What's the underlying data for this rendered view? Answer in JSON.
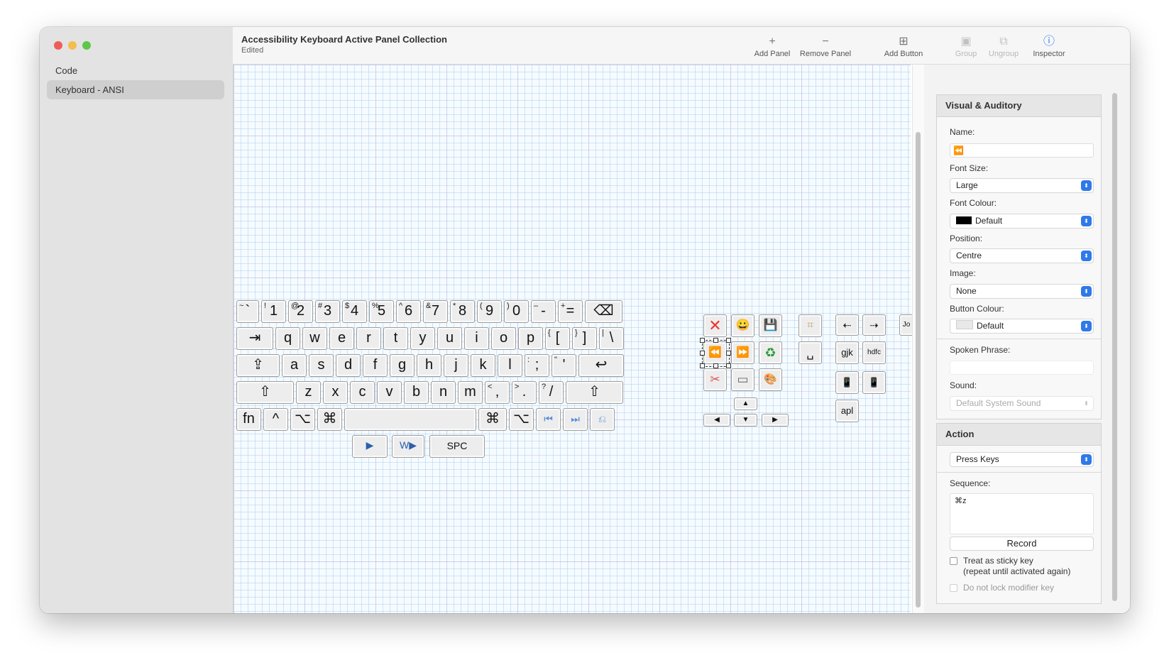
{
  "sidebar": {
    "items": [
      {
        "label": "Code"
      },
      {
        "label": "Keyboard - ANSI"
      }
    ]
  },
  "header": {
    "title": "Accessibility Keyboard Active Panel Collection",
    "subtitle": "Edited"
  },
  "toolbar": {
    "add_panel": "Add Panel",
    "add_panel_icon": "+",
    "remove_panel": "Remove Panel",
    "remove_panel_icon": "−",
    "add_button": "Add Button",
    "add_button_icon": "⊞",
    "group": "Group",
    "group_icon": "▣",
    "ungroup": "Ungroup",
    "ungroup_icon": "⧉",
    "inspector": "Inspector",
    "inspector_icon": "ⓘ"
  },
  "keyboard": {
    "row1": [
      {
        "m": "`",
        "k": "~"
      },
      {
        "m": "1",
        "k": "!"
      },
      {
        "m": "2",
        "k": "@"
      },
      {
        "m": "3",
        "k": "#"
      },
      {
        "m": "4",
        "k": "$"
      },
      {
        "m": "5",
        "k": "%"
      },
      {
        "m": "6",
        "k": "^"
      },
      {
        "m": "7",
        "k": "&"
      },
      {
        "m": "8",
        "k": "*"
      },
      {
        "m": "9",
        "k": "("
      },
      {
        "m": "0",
        "k": ")"
      },
      {
        "m": "-",
        "k": "–"
      },
      {
        "m": "=",
        "k": "+"
      },
      {
        "m": "⌫",
        "k": ""
      }
    ],
    "row2": [
      {
        "m": "⇥",
        "k": ""
      },
      {
        "m": "q",
        "k": ""
      },
      {
        "m": "w",
        "k": ""
      },
      {
        "m": "e",
        "k": ""
      },
      {
        "m": "r",
        "k": ""
      },
      {
        "m": "t",
        "k": ""
      },
      {
        "m": "y",
        "k": ""
      },
      {
        "m": "u",
        "k": ""
      },
      {
        "m": "i",
        "k": ""
      },
      {
        "m": "o",
        "k": ""
      },
      {
        "m": "p",
        "k": ""
      },
      {
        "m": "[",
        "k": "{"
      },
      {
        "m": "]",
        "k": "}"
      },
      {
        "m": "\\",
        "k": "|"
      }
    ],
    "row3": [
      {
        "m": "⇪",
        "k": ""
      },
      {
        "m": "a",
        "k": ""
      },
      {
        "m": "s",
        "k": ""
      },
      {
        "m": "d",
        "k": ""
      },
      {
        "m": "f",
        "k": ""
      },
      {
        "m": "g",
        "k": ""
      },
      {
        "m": "h",
        "k": ""
      },
      {
        "m": "j",
        "k": ""
      },
      {
        "m": "k",
        "k": ""
      },
      {
        "m": "l",
        "k": ""
      },
      {
        "m": ";",
        "k": ":"
      },
      {
        "m": "'",
        "k": "\""
      },
      {
        "m": "↩",
        "k": ""
      }
    ],
    "row4": [
      {
        "m": "⇧",
        "k": ""
      },
      {
        "m": "z",
        "k": ""
      },
      {
        "m": "x",
        "k": ""
      },
      {
        "m": "c",
        "k": ""
      },
      {
        "m": "v",
        "k": ""
      },
      {
        "m": "b",
        "k": ""
      },
      {
        "m": "n",
        "k": ""
      },
      {
        "m": "m",
        "k": ""
      },
      {
        "m": ",",
        "k": "<"
      },
      {
        "m": ".",
        "k": ">"
      },
      {
        "m": "/",
        "k": "?"
      },
      {
        "m": "⇧",
        "k": ""
      }
    ],
    "row5": [
      {
        "m": "fn"
      },
      {
        "m": "^"
      },
      {
        "m": "⌥"
      },
      {
        "m": "⌘"
      },
      {
        "m": ""
      },
      {
        "m": "⌘"
      },
      {
        "m": "⌥"
      },
      {
        "m": "⏮"
      },
      {
        "m": "⏭"
      },
      {
        "m": "⎌"
      }
    ],
    "row6": [
      {
        "m": "▶"
      },
      {
        "m": "W▶"
      },
      {
        "m": "SPC"
      }
    ]
  },
  "actions": {
    "close": "✕",
    "emoji": "😀",
    "save": "💾",
    "rewind": "⏪",
    "fastforward": "⏩",
    "recycle": "♻",
    "cut": "✂",
    "window": "▭",
    "palette": "🎨",
    "crop": "⌗",
    "space_char": "␣",
    "arrow_up": "▲",
    "arrow_left": "◀",
    "arrow_down": "▼",
    "arrow_right": "▶",
    "word_left": "⇠",
    "word_right": "⇢",
    "jo": "Jo @",
    "gjk": "gjk",
    "hdfc": "hdfc",
    "phone1": "📱",
    "phone2": "📱",
    "apl": "apl"
  },
  "inspector": {
    "visual_title": "Visual & Auditory",
    "name_label": "Name:",
    "name_value_icon": "⏪",
    "font_size_label": "Font Size:",
    "font_size_value": "Large",
    "font_colour_label": "Font Colour:",
    "font_colour_value": "Default",
    "position_label": "Position:",
    "position_value": "Centre",
    "image_label": "Image:",
    "image_value": "None",
    "button_colour_label": "Button Colour:",
    "button_colour_value": "Default",
    "spoken_label": "Spoken Phrase:",
    "spoken_value": "",
    "sound_label": "Sound:",
    "sound_value": "Default System Sound",
    "action_title": "Action",
    "action_value": "Press Keys",
    "sequence_label": "Sequence:",
    "sequence_value": "⌘z",
    "record": "Record",
    "sticky_label": "Treat as sticky key",
    "sticky_sub": "(repeat until activated again)",
    "lock_label": "Do not lock modifier key",
    "popup_arrow": "⬍"
  },
  "colors": {
    "accent": "#2f79e8",
    "close": "#ec5f57",
    "minimize": "#f4bd4f",
    "zoom": "#5dc748",
    "font_colour_swatch": "#000000",
    "button_colour_swatch": "#e8e8e8"
  }
}
